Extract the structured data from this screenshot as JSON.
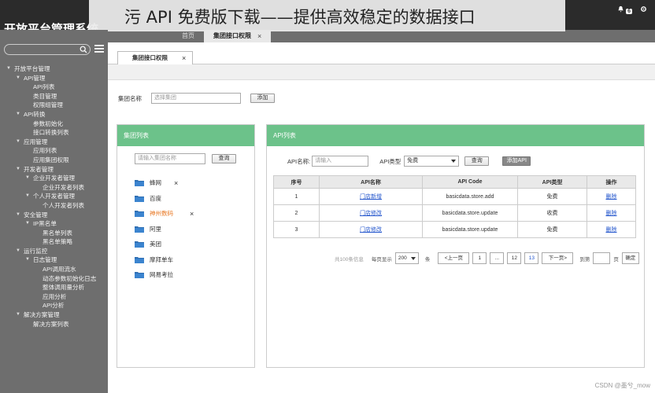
{
  "banner": {
    "text": "污 API 免费版下载——提供高效稳定的数据接口"
  },
  "app": {
    "title": "开放平台管理系统"
  },
  "top_tabs": [
    {
      "label": "首页"
    },
    {
      "label": "集团接口权限",
      "close": "×"
    }
  ],
  "top_right": {
    "notify_count": "6"
  },
  "sidebar": {
    "items": [
      {
        "label": "开放平台管理",
        "level": 0,
        "expanded": true
      },
      {
        "label": "API管理",
        "level": 1,
        "expanded": true
      },
      {
        "label": "API列表",
        "level": 2
      },
      {
        "label": "类目管理",
        "level": 2
      },
      {
        "label": "权限组管理",
        "level": 2
      },
      {
        "label": "API转换",
        "level": 1,
        "expanded": true
      },
      {
        "label": "参数初始化",
        "level": 2
      },
      {
        "label": "接口转换列表",
        "level": 2
      },
      {
        "label": "应用管理",
        "level": 1,
        "expanded": true
      },
      {
        "label": "应用列表",
        "level": 2
      },
      {
        "label": "应用集团权限",
        "level": 2
      },
      {
        "label": "开发者管理",
        "level": 1,
        "expanded": true
      },
      {
        "label": "企业开发者管理",
        "level": 2,
        "expanded": true
      },
      {
        "label": "企业开发者列表",
        "level": 3
      },
      {
        "label": "个人开发者管理",
        "level": 2,
        "expanded": true
      },
      {
        "label": "个人开发者列表",
        "level": 3
      },
      {
        "label": "安全管理",
        "level": 1,
        "expanded": true
      },
      {
        "label": "IP黑名单",
        "level": 2,
        "expanded": true
      },
      {
        "label": "黑名单列表",
        "level": 3
      },
      {
        "label": "黑名单策略",
        "level": 3
      },
      {
        "label": "运行监控",
        "level": 1,
        "expanded": true
      },
      {
        "label": "日志管理",
        "level": 2,
        "expanded": true
      },
      {
        "label": "API调用流水",
        "level": 3
      },
      {
        "label": "动态参数初始化日志",
        "level": 3
      },
      {
        "label": "整体调用量分析",
        "level": 3
      },
      {
        "label": "应用分析",
        "level": 3
      },
      {
        "label": "API分析",
        "level": 3
      },
      {
        "label": "解决方案管理",
        "level": 1,
        "expanded": true
      },
      {
        "label": "解决方案列表",
        "level": 2
      }
    ]
  },
  "sub_tab": {
    "label": "集团接口权限",
    "close": "×"
  },
  "group_filter": {
    "label": "集团名称",
    "placeholder": "选择集团",
    "add_label": "添加"
  },
  "left_panel": {
    "title": "集团列表",
    "search_placeholder": "请输入集团名称",
    "search_label": "查询",
    "groups": [
      {
        "name": "蜂网",
        "removable": true,
        "highlight": false
      },
      {
        "name": "百度",
        "removable": false,
        "highlight": false
      },
      {
        "name": "神州数码",
        "removable": true,
        "highlight": true
      },
      {
        "name": "阿里",
        "removable": false,
        "highlight": false
      },
      {
        "name": "美团",
        "removable": false,
        "highlight": false
      },
      {
        "name": "摩拜单车",
        "removable": false,
        "highlight": false
      },
      {
        "name": "网易考拉",
        "removable": false,
        "highlight": false
      }
    ],
    "remove_glyph": "×"
  },
  "right_panel": {
    "title": "API列表",
    "name_label": "API名称:",
    "name_placeholder": "请输入",
    "type_label": "API类型",
    "type_value": "免费",
    "search_label": "查询",
    "add_label": "添加API",
    "columns": [
      "序号",
      "API名称",
      "API Code",
      "API类型",
      "操作"
    ],
    "rows": [
      {
        "index": "1",
        "name": "门店新增",
        "code": "basicdata.store.add",
        "type": "免费",
        "action": "删除"
      },
      {
        "index": "2",
        "name": "门店修改",
        "code": "basicdata.store.update",
        "type": "收费",
        "action": "删除"
      },
      {
        "index": "3",
        "name": "门店修改",
        "code": "basicdata.store.update",
        "type": "免费",
        "action": "删除"
      }
    ]
  },
  "pager": {
    "total": "共100条信息",
    "per_page_label": "每页显示",
    "per_page_value": "200",
    "unit": "条",
    "prev": "<上一页",
    "p1": "1",
    "ellipsis": "...",
    "p12": "12",
    "current": "13",
    "next": "下一页>",
    "goto_label": "到第",
    "page_unit": "页",
    "confirm": "确定"
  },
  "watermark": "CSDN @墨兮_mow",
  "colors": {
    "accent": "#6cc28a",
    "link": "#2255cc",
    "highlight": "#e87722"
  }
}
